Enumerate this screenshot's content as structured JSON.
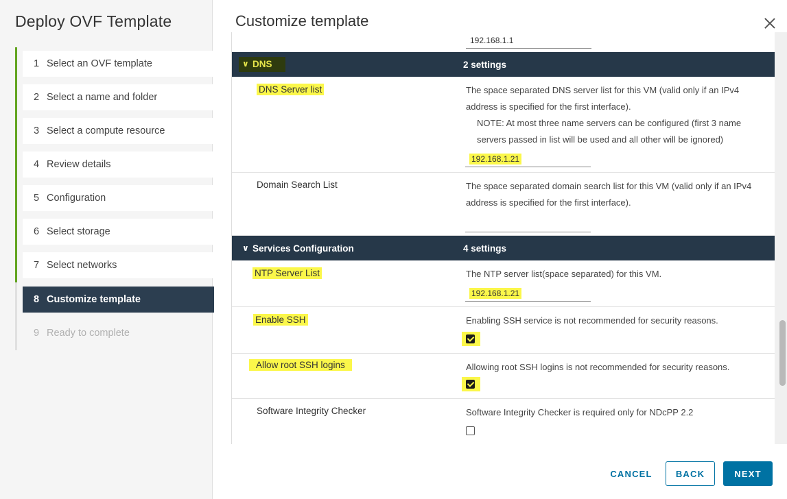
{
  "wizard": {
    "title": "Deploy OVF Template",
    "steps": [
      {
        "num": "1",
        "label": "Select an OVF template"
      },
      {
        "num": "2",
        "label": "Select a name and folder"
      },
      {
        "num": "3",
        "label": "Select a compute resource"
      },
      {
        "num": "4",
        "label": "Review details"
      },
      {
        "num": "5",
        "label": "Configuration"
      },
      {
        "num": "6",
        "label": "Select storage"
      },
      {
        "num": "7",
        "label": "Select networks"
      },
      {
        "num": "8",
        "label": "Customize template"
      },
      {
        "num": "9",
        "label": "Ready to complete"
      }
    ],
    "current_step": 8
  },
  "content": {
    "title": "Customize template",
    "top_field_value": "192.168.1.1",
    "dns": {
      "name": "DNS",
      "count": "2 settings",
      "server_list": {
        "label": "DNS Server list",
        "desc1": "The space separated DNS server list for this VM (valid only if an IPv4 address is specified for the first interface).",
        "desc2": "NOTE: At most three name servers can be configured (first 3 name servers passed in list will be used and all other will be ignored)",
        "value": "192.168.1.21"
      },
      "domain_search": {
        "label": "Domain Search List",
        "desc": "The space separated domain search list for this VM (valid only if an IPv4 address is specified for the first interface).",
        "value": ""
      }
    },
    "services": {
      "name": "Services Configuration",
      "count": "4 settings",
      "ntp": {
        "label": "NTP Server List",
        "desc": "The NTP server list(space separated) for this VM.",
        "value": "192.168.1.21"
      },
      "ssh": {
        "label": "Enable SSH",
        "desc": "Enabling SSH service is not recommended for security reasons.",
        "checked": true
      },
      "root_ssh": {
        "label": "Allow root SSH logins",
        "desc": "Allowing root SSH logins is not recommended for security reasons.",
        "checked": true
      },
      "integrity": {
        "label": "Software Integrity Checker",
        "desc": "Software Integrity Checker is required only for NDcPP 2.2",
        "checked": false
      }
    }
  },
  "footer": {
    "cancel": "CANCEL",
    "back": "BACK",
    "next": "NEXT"
  },
  "colors": {
    "highlight": "#fbf74a",
    "section_header": "#263849",
    "progress_green": "#62a420",
    "primary_blue": "#0072a3",
    "current_step_bg": "#2c3e50"
  }
}
